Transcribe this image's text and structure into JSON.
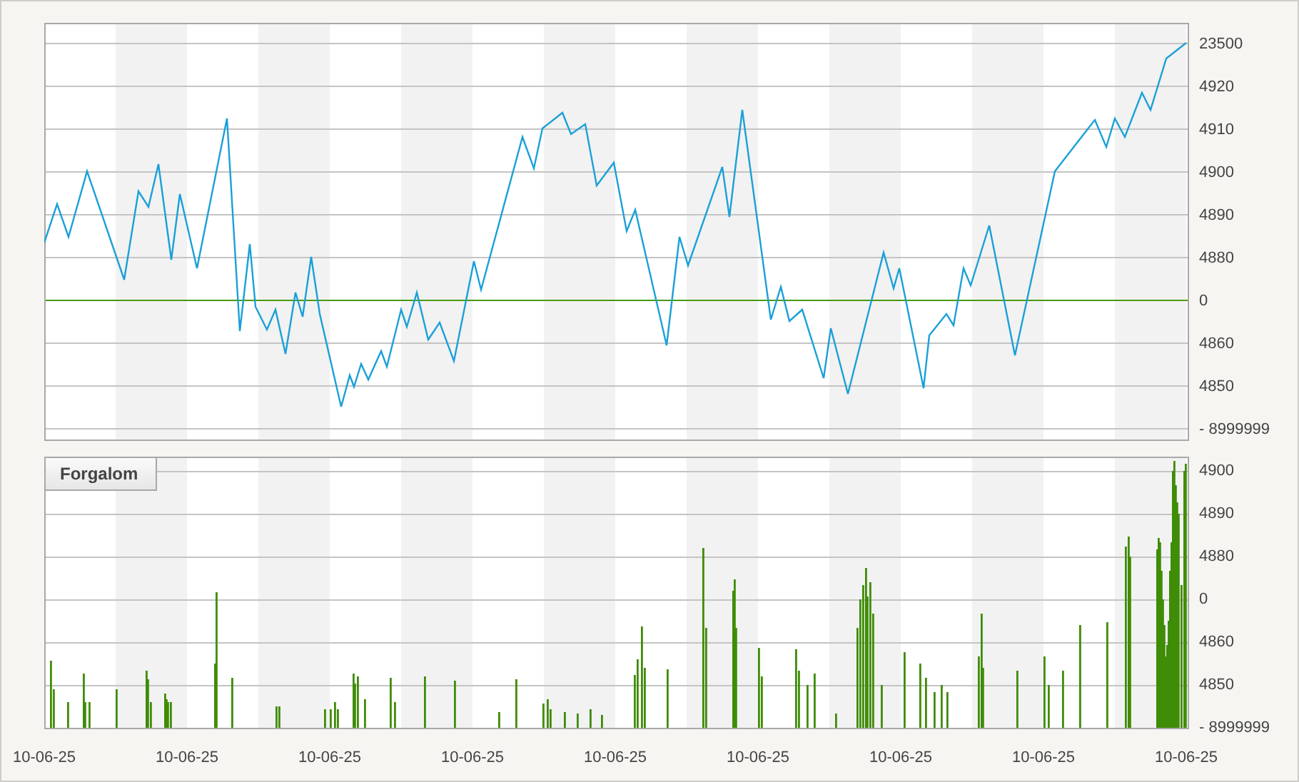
{
  "price_chart": {
    "y_labels": [
      "23500",
      "4920",
      "4910",
      "4900",
      "4890",
      "4880",
      "0",
      "4860",
      "4850",
      "- 8999999"
    ]
  },
  "volume_chart": {
    "legend": "Forgalom",
    "y_labels": [
      "4900",
      "4890",
      "4880",
      "0",
      "4860",
      "4850",
      "- 8999999"
    ]
  },
  "x_labels": [
    "10-06-25",
    "10-06-25",
    "10-06-25",
    "10-06-25",
    "10-06-25",
    "10-06-25",
    "10-06-25",
    "10-06-25",
    "10-06-25"
  ]
}
